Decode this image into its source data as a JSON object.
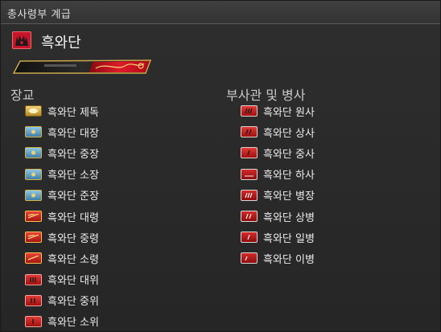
{
  "window": {
    "title": "총사령부 계급"
  },
  "header": {
    "gc_name": "흑와단",
    "emblem_icon": "flame-emblem-icon",
    "accent": "#c8142a"
  },
  "officers": {
    "title": "장교",
    "items": [
      {
        "label": "흑와단 제독",
        "icon": "gold-insignia-icon"
      },
      {
        "label": "흑와단 대장",
        "icon": "blue-gold-insignia-icon"
      },
      {
        "label": "흑와단 중장",
        "icon": "blue-gold-insignia-icon"
      },
      {
        "label": "흑와단 소장",
        "icon": "blue-gold-insignia-icon"
      },
      {
        "label": "흑와단 준장",
        "icon": "blue-gold-insignia-icon"
      },
      {
        "label": "흑와단 대령",
        "icon": "red-gold-bars-icon"
      },
      {
        "label": "흑와단 중령",
        "icon": "red-gold-bars-icon"
      },
      {
        "label": "흑와단 소령",
        "icon": "red-gold-bars-icon"
      },
      {
        "label": "흑와단 대위",
        "icon": "red-stripes-icon"
      },
      {
        "label": "흑와단 중위",
        "icon": "red-stripes-icon"
      },
      {
        "label": "흑와단 소위",
        "icon": "red-stripes-icon"
      }
    ]
  },
  "ncos": {
    "title": "부사관 및 병사",
    "items": [
      {
        "label": "흑와단 원사",
        "icon": "red-chevron-icon"
      },
      {
        "label": "흑와단 상사",
        "icon": "red-chevron-icon"
      },
      {
        "label": "흑와단 중사",
        "icon": "red-chevron-icon"
      },
      {
        "label": "흑와단 하사",
        "icon": "red-chevron-icon"
      },
      {
        "label": "흑와단 병장",
        "icon": "red-chevron-icon"
      },
      {
        "label": "흑와단 상병",
        "icon": "red-chevron-icon"
      },
      {
        "label": "흑와단 일병",
        "icon": "red-chevron-icon"
      },
      {
        "label": "흑와단 이병",
        "icon": "red-chevron-icon"
      }
    ]
  }
}
